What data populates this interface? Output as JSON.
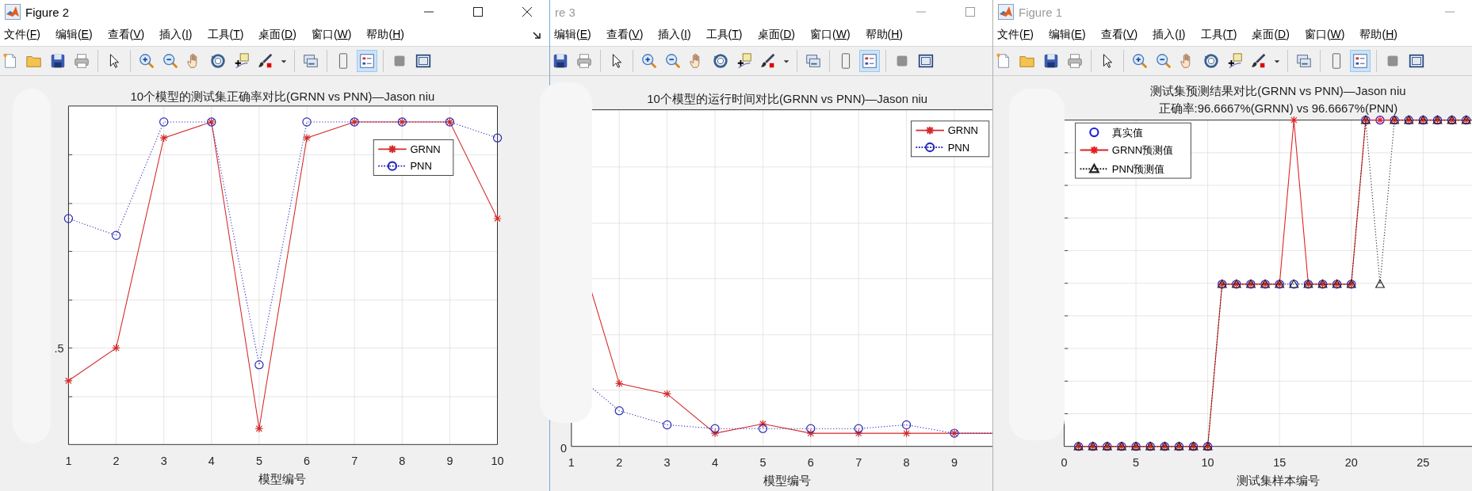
{
  "windows": [
    {
      "title": "Figure 2",
      "active": true,
      "show_icon": true,
      "dock_button": true,
      "controls": [
        {
          "kind": "minimize"
        },
        {
          "kind": "maximize"
        },
        {
          "kind": "close"
        }
      ],
      "menu": [
        "文件(F)",
        "编辑(E)",
        "查看(V)",
        "插入(I)",
        "工具(T)",
        "桌面(D)",
        "窗口(W)",
        "帮助(H)"
      ],
      "toolbar": [
        {
          "kind": "new-file",
          "selected": false
        },
        {
          "kind": "open-folder",
          "selected": false
        },
        {
          "kind": "save",
          "selected": false
        },
        {
          "kind": "print",
          "selected": false
        },
        {
          "kind": "separator"
        },
        {
          "kind": "pointer",
          "selected": false
        },
        {
          "kind": "separator"
        },
        {
          "kind": "zoom-in",
          "selected": false
        },
        {
          "kind": "zoom-out",
          "selected": false
        },
        {
          "kind": "pan",
          "selected": false
        },
        {
          "kind": "rotate",
          "selected": false
        },
        {
          "kind": "data-cursor",
          "selected": false
        },
        {
          "kind": "brush",
          "selected": false
        },
        {
          "kind": "caret",
          "selected": false
        },
        {
          "kind": "separator"
        },
        {
          "kind": "link-plot",
          "selected": false
        },
        {
          "kind": "separator"
        },
        {
          "kind": "colorbar",
          "selected": false
        },
        {
          "kind": "legend",
          "selected": true
        },
        {
          "kind": "separator"
        },
        {
          "kind": "hide-tools",
          "selected": false
        },
        {
          "kind": "frame",
          "selected": false
        }
      ],
      "plot": {
        "kind": "accuracy",
        "title": [
          "10个模型的测试集正确率对比(GRNN vs PNN)—Jason niu"
        ],
        "xticks": [
          "1",
          "2",
          "3",
          "4",
          "5",
          "6",
          "7",
          "8",
          "9",
          "10"
        ],
        "yticks": [
          ".5"
        ],
        "xlabel": "模型编号",
        "legend": [
          {
            "label": "GRNN",
            "kind": "asterisk-solid",
            "color": "#d42a2a"
          },
          {
            "label": "PNN",
            "kind": "circle-dotted",
            "color": "#2a2ab8"
          }
        ]
      }
    },
    {
      "title": "re 3",
      "active": false,
      "show_icon": false,
      "dock_button": false,
      "controls": [
        {
          "kind": "minimize"
        },
        {
          "kind": "maximize"
        }
      ],
      "menu": [
        "编辑(E)",
        "查看(V)",
        "插入(I)",
        "工具(T)",
        "桌面(D)",
        "窗口(W)",
        "帮助(H)"
      ],
      "toolbar": [
        {
          "kind": "save",
          "selected": false
        },
        {
          "kind": "print",
          "selected": false
        },
        {
          "kind": "separator"
        },
        {
          "kind": "pointer",
          "selected": false
        },
        {
          "kind": "separator"
        },
        {
          "kind": "zoom-in",
          "selected": false
        },
        {
          "kind": "zoom-out",
          "selected": false
        },
        {
          "kind": "pan",
          "selected": false
        },
        {
          "kind": "rotate",
          "selected": false
        },
        {
          "kind": "data-cursor",
          "selected": false
        },
        {
          "kind": "brush",
          "selected": false
        },
        {
          "kind": "caret",
          "selected": false
        },
        {
          "kind": "separator"
        },
        {
          "kind": "link-plot",
          "selected": false
        },
        {
          "kind": "separator"
        },
        {
          "kind": "colorbar",
          "selected": false
        },
        {
          "kind": "legend",
          "selected": true
        },
        {
          "kind": "separator"
        },
        {
          "kind": "hide-tools",
          "selected": false
        },
        {
          "kind": "frame",
          "selected": false
        }
      ],
      "plot": {
        "kind": "runtime",
        "title": [
          "10个模型的运行时间对比(GRNN vs PNN)—Jason niu"
        ],
        "xticks": [
          "1",
          "2",
          "3",
          "4",
          "5",
          "6",
          "7",
          "8",
          "9"
        ],
        "yticks": [
          "0"
        ],
        "xlabel": "模型编号",
        "legend": [
          {
            "label": "GRNN",
            "kind": "asterisk-solid",
            "color": "#d42a2a"
          },
          {
            "label": "PNN",
            "kind": "circle-dotted",
            "color": "#2a2ab8"
          }
        ]
      }
    },
    {
      "title": "Figure 1",
      "active": false,
      "show_icon": true,
      "dock_button": false,
      "controls": [
        {
          "kind": "minimize"
        }
      ],
      "menu": [
        "文件(F)",
        "编辑(E)",
        "查看(V)",
        "插入(I)",
        "工具(T)",
        "桌面(D)",
        "窗口(W)",
        "帮助(H)"
      ],
      "toolbar": [
        {
          "kind": "new-file",
          "selected": false
        },
        {
          "kind": "open-folder",
          "selected": false
        },
        {
          "kind": "save",
          "selected": false
        },
        {
          "kind": "print",
          "selected": false
        },
        {
          "kind": "separator"
        },
        {
          "kind": "pointer",
          "selected": false
        },
        {
          "kind": "separator"
        },
        {
          "kind": "zoom-in",
          "selected": false
        },
        {
          "kind": "zoom-out",
          "selected": false
        },
        {
          "kind": "pan",
          "selected": false
        },
        {
          "kind": "rotate",
          "selected": false
        },
        {
          "kind": "data-cursor",
          "selected": false
        },
        {
          "kind": "brush",
          "selected": false
        },
        {
          "kind": "caret",
          "selected": false
        },
        {
          "kind": "separator"
        },
        {
          "kind": "link-plot",
          "selected": false
        },
        {
          "kind": "separator"
        },
        {
          "kind": "colorbar",
          "selected": false
        },
        {
          "kind": "legend",
          "selected": true
        },
        {
          "kind": "separator"
        },
        {
          "kind": "hide-tools",
          "selected": false
        },
        {
          "kind": "frame",
          "selected": false
        }
      ],
      "plot": {
        "kind": "prediction",
        "title": [
          "测试集预测结果对比(GRNN vs PNN)—Jason niu",
          "正确率:96.6667%(GRNN) vs 96.6667%(PNN)"
        ],
        "xticks": [
          "0",
          "5",
          "10",
          "15",
          "20",
          "25"
        ],
        "xlabel": "测试集样本编号",
        "legend": [
          {
            "label": "真实值",
            "kind": "circle",
            "color": "#2020e0"
          },
          {
            "label": "GRNN预测值",
            "kind": "asterisk-solid",
            "color": "#e02020"
          },
          {
            "label": "PNN预测值",
            "kind": "triangle-dotted",
            "color": "#202020"
          }
        ]
      }
    }
  ]
}
